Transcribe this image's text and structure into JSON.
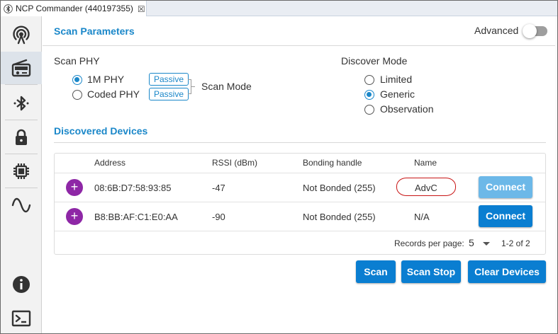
{
  "tab": {
    "title": "NCP Commander (440197355)",
    "close": "☒"
  },
  "sidebar": {
    "items": [
      {
        "icon": "broadcast-icon"
      },
      {
        "icon": "radio-icon",
        "active": true
      },
      {
        "icon": "bluetooth-icon"
      },
      {
        "icon": "lock-icon"
      },
      {
        "icon": "chip-icon"
      },
      {
        "icon": "waveform-icon"
      },
      {
        "icon": "info-icon"
      },
      {
        "icon": "terminal-icon"
      }
    ]
  },
  "scan_parameters": {
    "title": "Scan Parameters",
    "advanced_label": "Advanced",
    "advanced_on": false,
    "scan_phy_label": "Scan PHY",
    "phy_options": [
      {
        "label": "1M PHY",
        "checked": true,
        "mode": "Passive"
      },
      {
        "label": "Coded PHY",
        "checked": false,
        "mode": "Passive"
      }
    ],
    "scan_mode_label": "Scan Mode",
    "discover_mode_label": "Discover Mode",
    "discover_options": [
      {
        "label": "Limited",
        "checked": false
      },
      {
        "label": "Generic",
        "checked": true
      },
      {
        "label": "Observation",
        "checked": false
      }
    ]
  },
  "devices": {
    "title": "Discovered Devices",
    "columns": [
      "Address",
      "RSSI (dBm)",
      "Bonding handle",
      "Name"
    ],
    "rows": [
      {
        "expand": "+",
        "address": "08:6B:D7:58:93:85",
        "rssi": "-47",
        "bonding": "Not Bonded (255)",
        "name": "AdvC",
        "action": "Connect"
      },
      {
        "expand": "+",
        "address": "B8:BB:AF:C1:E0:AA",
        "rssi": "-90",
        "bonding": "Not Bonded (255)",
        "name": "N/A",
        "action": "Connect"
      }
    ],
    "pager": {
      "label": "Records per page:",
      "per_page": "5",
      "range": "1-2 of 2"
    }
  },
  "actions": {
    "scan": "Scan",
    "scan_stop": "Scan Stop",
    "clear": "Clear Devices"
  },
  "colors": {
    "accent": "#1a87c9",
    "button": "#0a7ed1",
    "expand": "#8e27a6",
    "highlight": "#c81414"
  }
}
